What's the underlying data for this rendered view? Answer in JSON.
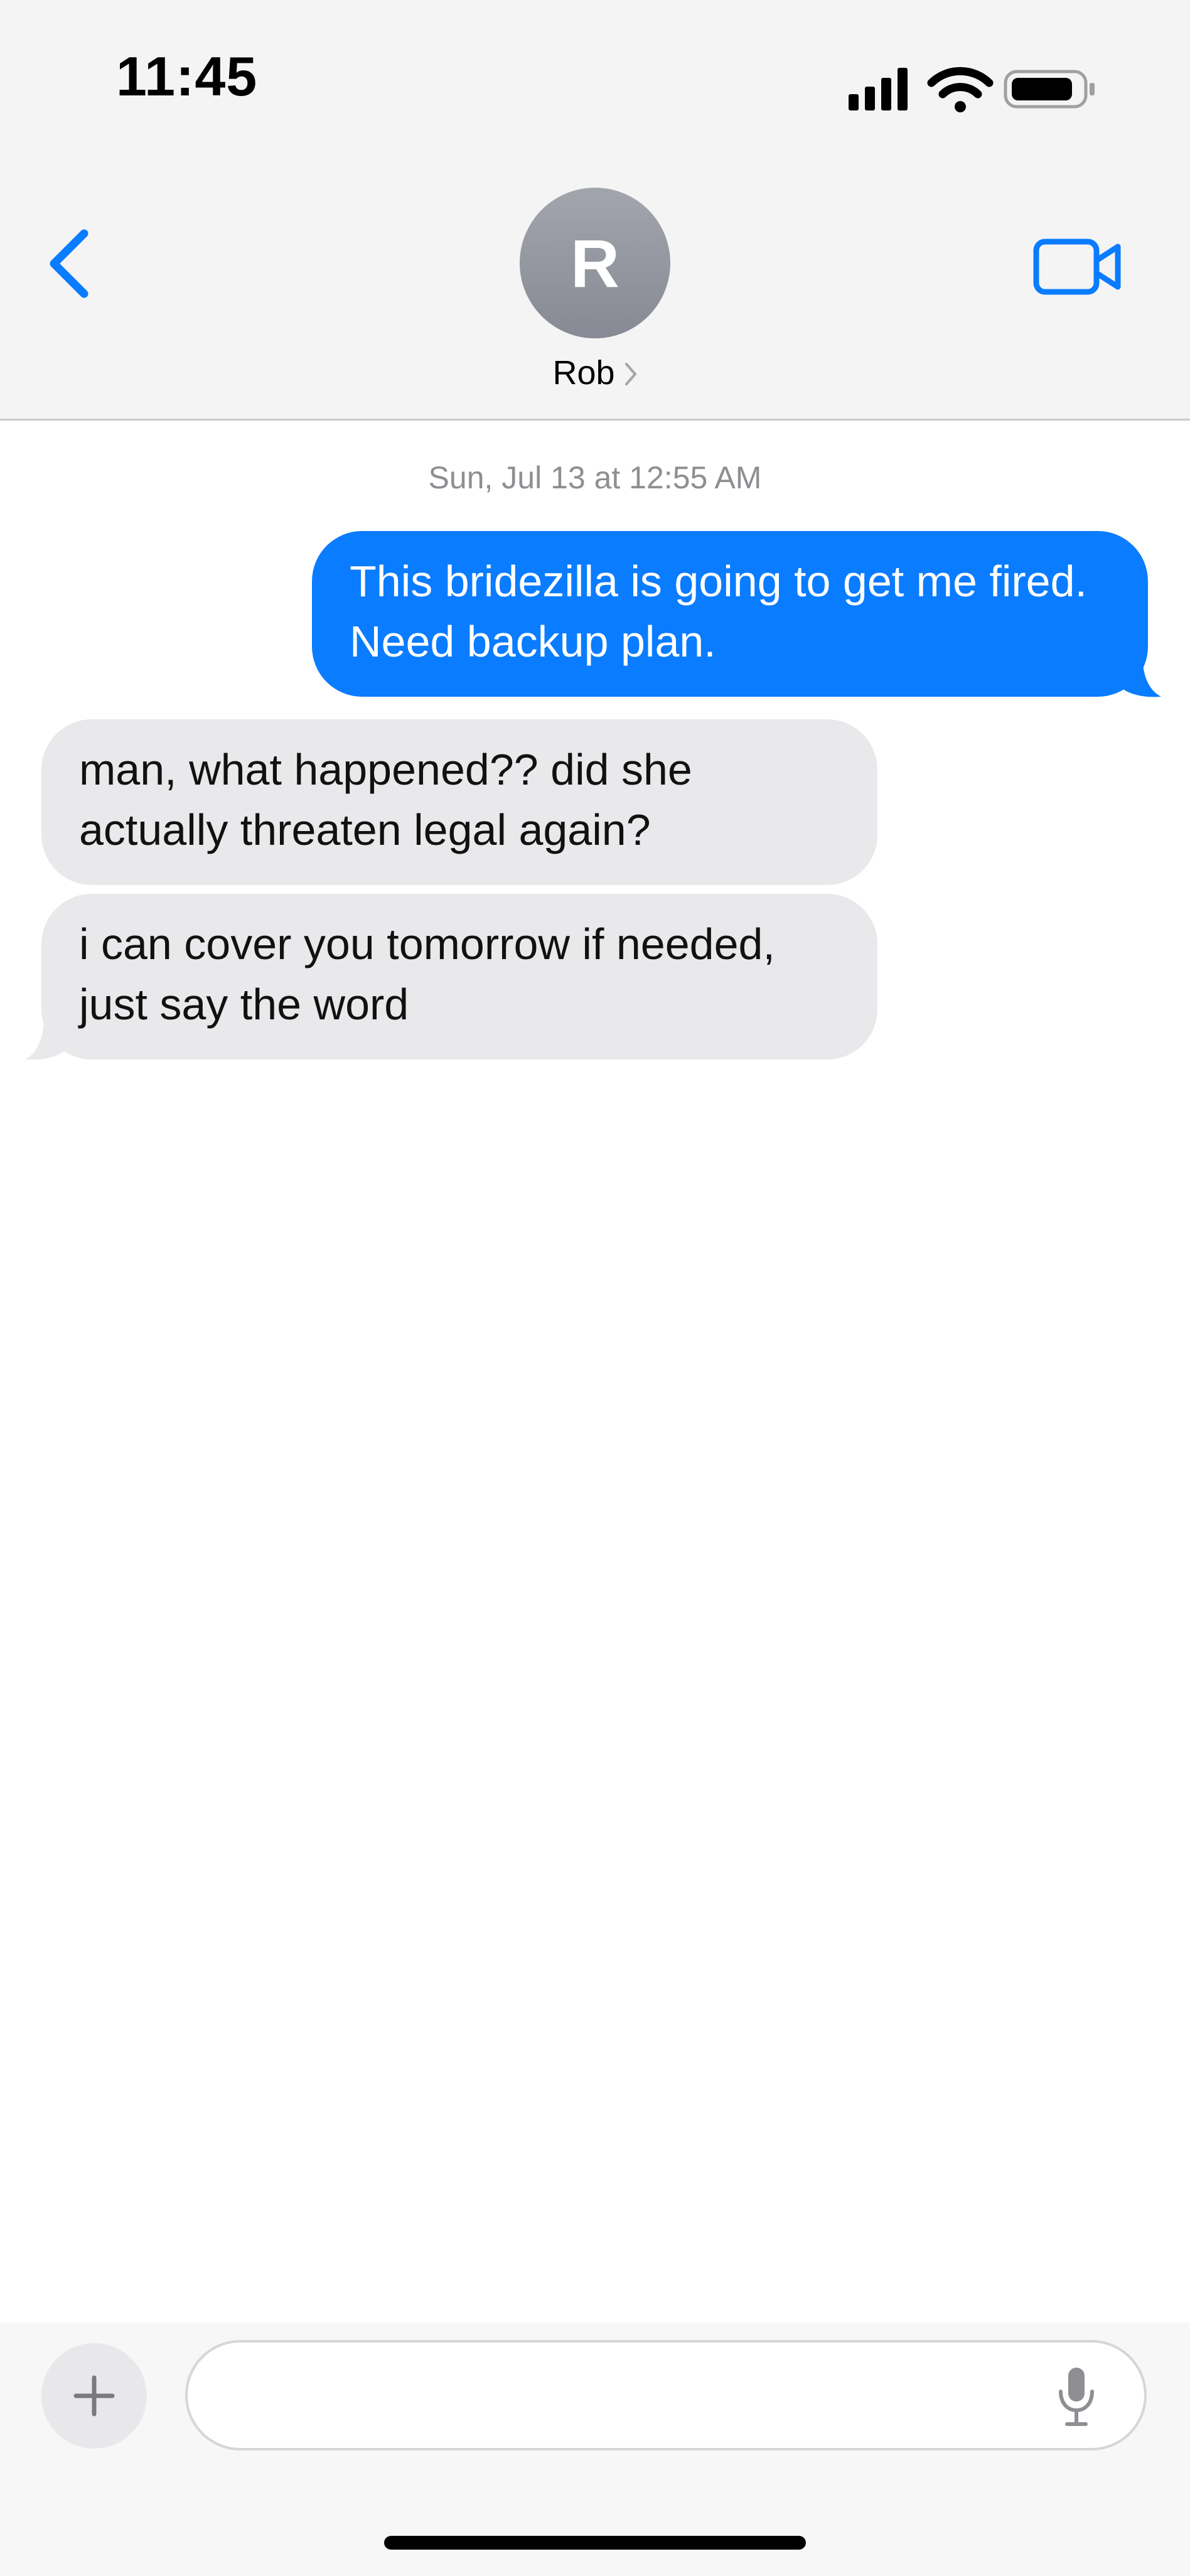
{
  "status_bar": {
    "time": "11:45"
  },
  "header": {
    "avatar_initial": "R",
    "contact_name": "Rob",
    "icons": {
      "back": "chevron-left-icon",
      "video": "video-camera-icon",
      "chevron": "chevron-right-icon"
    }
  },
  "conversation": {
    "timestamp": "Sun, Jul 13 at 12:55 AM",
    "messages": [
      {
        "direction": "sent",
        "text": "This bridezilla is going to get me fired. Need backup plan."
      },
      {
        "direction": "received",
        "text": "man, what happened?? did she actually threaten legal again?"
      },
      {
        "direction": "received",
        "text": "i can cover you tomorrow if needed, just say the word"
      }
    ]
  },
  "composer": {
    "value": "",
    "placeholder": "",
    "icons": {
      "plus": "plus-icon",
      "mic": "microphone-icon"
    }
  },
  "colors": {
    "accent": "#0a7cff",
    "sent_bubble": "#0a7cff",
    "received_bubble": "#e9e9eb",
    "header_bg": "#f4f4f4",
    "timestamp_text": "#8e8e93"
  }
}
